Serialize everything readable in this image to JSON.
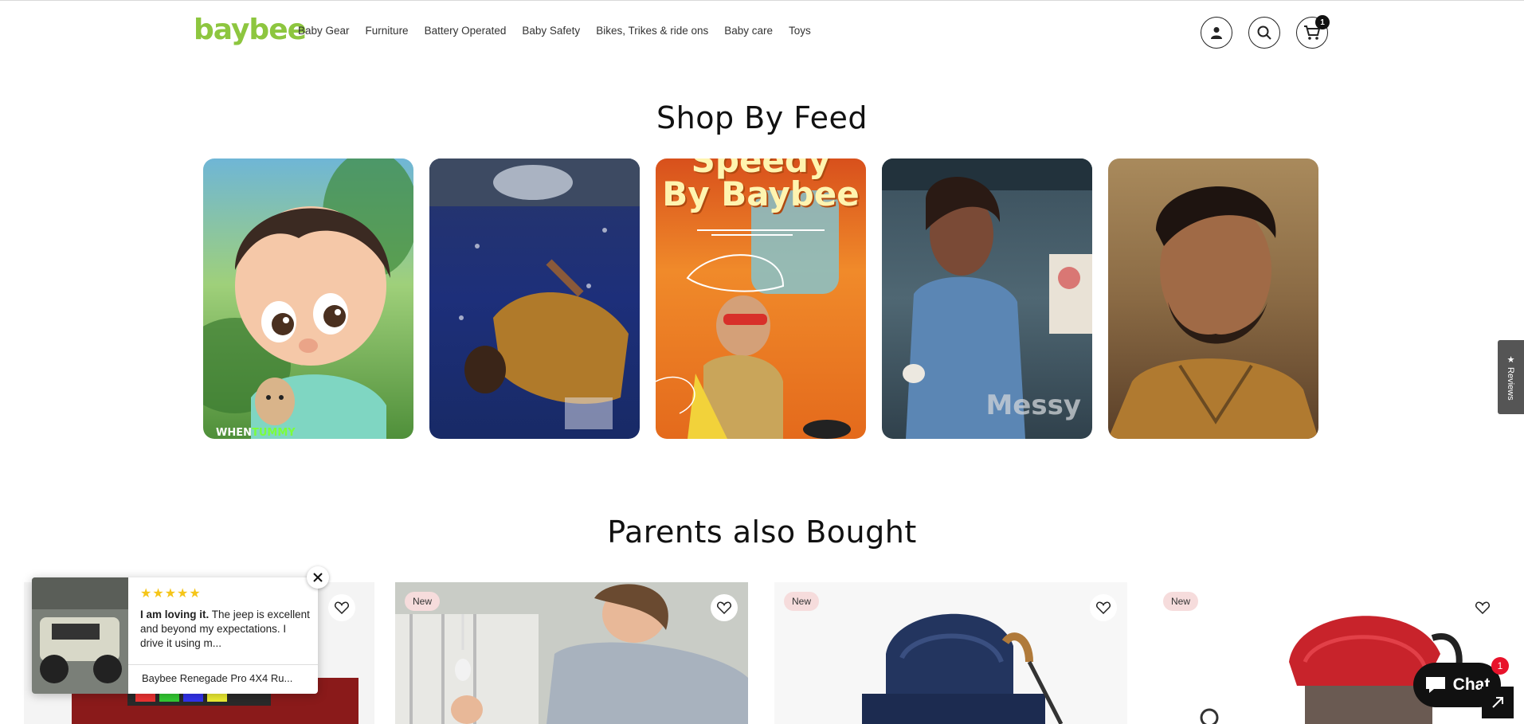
{
  "header": {
    "logo": "baybee",
    "nav": [
      "Baby Gear",
      "Furniture",
      "Battery Operated",
      "Baby Safety",
      "Bikes, Trikes & ride ons",
      "Baby care",
      "Toys"
    ],
    "cart_count": "1",
    "icons": [
      "account-icon",
      "search-icon",
      "cart-icon"
    ]
  },
  "feed": {
    "title": "Shop By Feed",
    "cards": [
      {
        "caption_a": "WHEN",
        "caption_b": "TUMMY"
      },
      {
        "caption_a": "",
        "caption_b": ""
      },
      {
        "caption_a": "Speedy",
        "caption_b": "By Baybee"
      },
      {
        "caption_a": "Messy",
        "caption_b": ""
      },
      {
        "caption_a": "",
        "caption_b": ""
      }
    ]
  },
  "products": {
    "title": "Parents also Bought",
    "badge": "New"
  },
  "reviews_tab": "★ Reviews",
  "review_popup": {
    "stars": "★★★★★",
    "bold": "I am loving it.",
    "text": " The jeep is excellent and beyond my expectations. I drive it using m...",
    "product": "Baybee Renegade Pro 4X4 Ru..."
  },
  "chat": {
    "label": "Chat",
    "badge": "1"
  },
  "colors": {
    "brand_green": "#8dc63f",
    "badge_pink": "#f6dcdc",
    "chat_black": "#111111",
    "chat_badge_red": "#e8132b"
  }
}
